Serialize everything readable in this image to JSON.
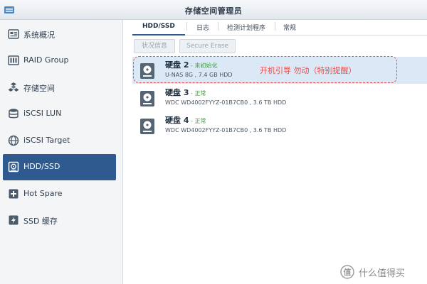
{
  "window": {
    "title": "存储空间管理员"
  },
  "sidebar": {
    "items": [
      {
        "label": "系统概况",
        "icon": "overview-icon"
      },
      {
        "label": "RAID Group",
        "icon": "raid-icon"
      },
      {
        "label": "存储空间",
        "icon": "volume-icon"
      },
      {
        "label": "iSCSI LUN",
        "icon": "lun-icon"
      },
      {
        "label": "iSCSI Target",
        "icon": "target-icon"
      },
      {
        "label": "HDD/SSD",
        "icon": "hdd-icon",
        "active": true
      },
      {
        "label": "Hot Spare",
        "icon": "hot-spare-icon"
      },
      {
        "label": "SSD 缓存",
        "icon": "ssd-cache-icon"
      }
    ]
  },
  "tabs": [
    {
      "label": "HDD/SSD",
      "active": true
    },
    {
      "label": "日志"
    },
    {
      "label": "检测计划程序"
    },
    {
      "label": "常规"
    }
  ],
  "toolbar": {
    "status_label": "状况信息",
    "erase_label": "Secure Erase"
  },
  "disks": [
    {
      "name": "硬盘 2",
      "status": " - 未初始化",
      "desc": "U-NAS 8G , 7.4 GB HDD"
    },
    {
      "name": "硬盘 3",
      "status": " - 正常",
      "desc": "WDC WD4002FYYZ-01B7CB0 , 3.6 TB HDD"
    },
    {
      "name": "硬盘 4",
      "status": " - 正常",
      "desc": "WDC WD4002FYYZ-01B7CB0 , 3.6 TB HDD"
    }
  ],
  "annotation": {
    "text": "开机引导 勿动（特别提醒）"
  },
  "watermark": {
    "text": "什么值得买"
  },
  "colors": {
    "accent": "#2f5a8f",
    "selected_row": "#dbe8f5",
    "status_ok": "#3aa33a",
    "annotation": "#e8504f"
  }
}
